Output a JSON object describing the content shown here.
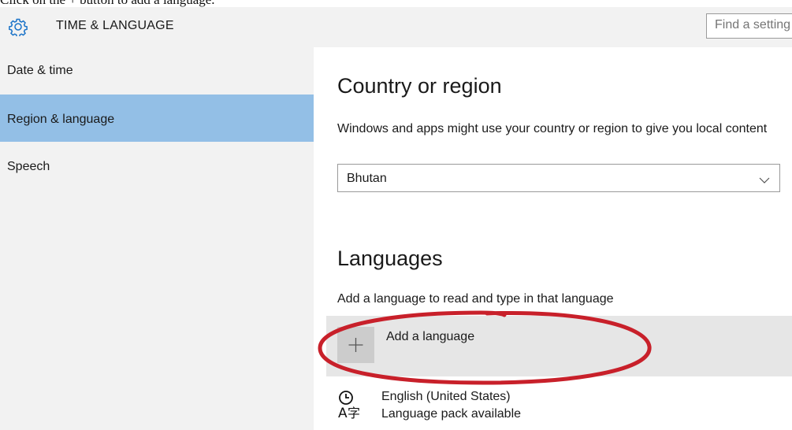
{
  "caption": "Click on the + button to add a language.",
  "window": {
    "title": "TIME & LANGUAGE",
    "icon": "gear-icon",
    "search_placeholder": "Find a setting"
  },
  "sidebar": {
    "items": [
      {
        "label": "Date & time",
        "selected": false
      },
      {
        "label": "Region & language",
        "selected": true
      },
      {
        "label": "Speech",
        "selected": false
      }
    ]
  },
  "region": {
    "heading": "Country or region",
    "description": "Windows and apps might use your country or region to give you local content",
    "selected_country": "Bhutan"
  },
  "languages": {
    "heading": "Languages",
    "description": "Add a language to read and type in that language",
    "add_label": "Add a language",
    "items": [
      {
        "name": "English (United States)",
        "status": "Language pack available",
        "icon": "language-icon"
      }
    ]
  },
  "colors": {
    "selected_item": "#93bfe6",
    "sidebar_bg": "#f2f2f2",
    "annotation": "#c8202a"
  }
}
